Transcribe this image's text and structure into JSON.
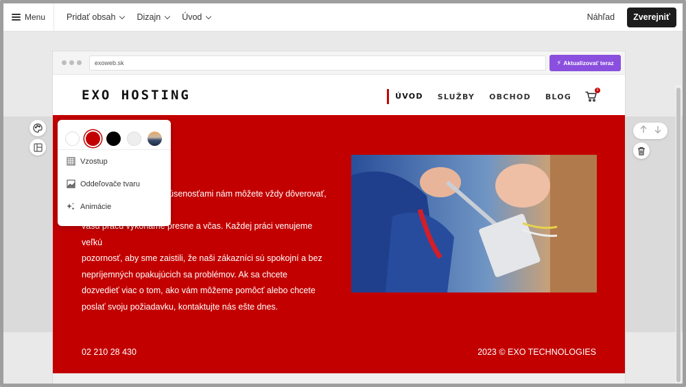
{
  "topbar": {
    "menu_label": "Menu",
    "items": [
      {
        "label": "Pridať obsah"
      },
      {
        "label": "Dizajn"
      },
      {
        "label": "Úvod"
      }
    ],
    "preview_label": "Náhľad",
    "publish_label": "Zverejniť"
  },
  "browser": {
    "url": "exoweb.sk",
    "upgrade_label": "Aktualizovať teraz"
  },
  "site": {
    "logo": "EXO HOSTING",
    "nav": [
      {
        "label": "ÚVOD"
      },
      {
        "label": "SLUŽBY"
      },
      {
        "label": "OBCHOD"
      },
      {
        "label": "BLOG"
      }
    ],
    "cart_count": "0",
    "body_lines": [
      "",
      "S našimi službami a skúsenosťami nám môžete vždy dôverovať, že",
      "vašu prácu vykonáme presne a včas. Každej práci venujeme veľkú",
      "pozornosť, aby sme zaistili, že naši zákazníci sú spokojní a bez",
      "nepríjemných opakujúcich sa problémov. Ak sa chcete",
      "dozvedieť viac o tom, ako vám môžeme pomôcť alebo chcete",
      "poslať svoju požiadavku, kontaktujte nás ešte dnes."
    ],
    "phone": "02 210 28 430",
    "copyright": "2023 © EXO TECHNOLOGIES"
  },
  "popover": {
    "swatch_colors": [
      "#ffffff",
      "#c30000",
      "#000000",
      "#eeeeee",
      "gradient"
    ],
    "selected_swatch": "#c30000",
    "items": [
      {
        "label": "Vzostup",
        "icon": "pattern-icon"
      },
      {
        "label": "Oddeľovače tvaru",
        "icon": "shape-divider-icon"
      },
      {
        "label": "Animácie",
        "icon": "sparkle-icon"
      }
    ]
  },
  "colors": {
    "accent_red": "#c30000",
    "upgrade_purple": "#8a4fde",
    "publish_dark": "#1c1c1c"
  }
}
